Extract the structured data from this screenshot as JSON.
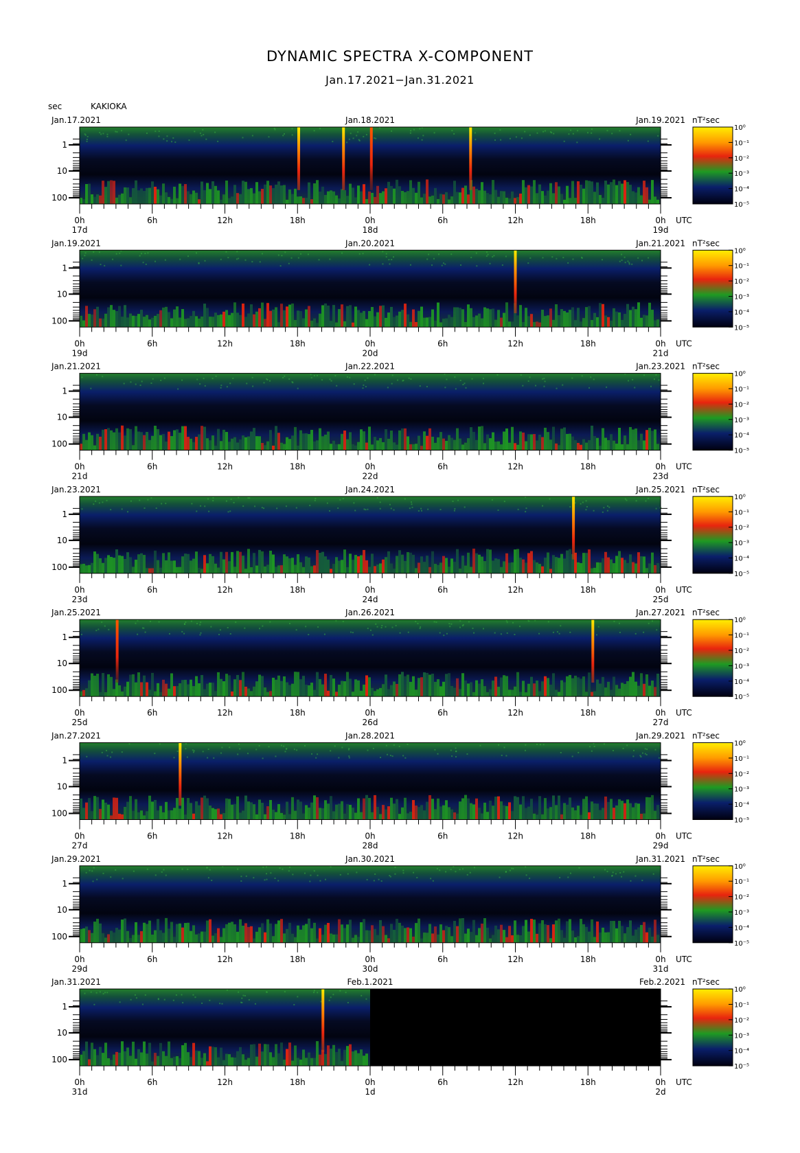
{
  "title": "DYNAMIC SPECTRA X-COMPONENT",
  "subtitle": "Jan.17.2021−Jan.31.2021",
  "unit_label": "sec",
  "station": "KAKIOKA",
  "colorbar_unit": "nT²sec",
  "colors": {
    "low": "#000000",
    "blue": "#0a1f6a",
    "green": "#1f9a22",
    "red": "#e8240e",
    "yellow": "#ffee00",
    "nodata": "#000000"
  },
  "chart_data": {
    "type": "heatmap",
    "xlabel": "UTC",
    "x_tick_labels": [
      "0h",
      "6h",
      "12h",
      "18h",
      "0h",
      "6h",
      "12h",
      "18h",
      "0h"
    ],
    "y_tick_labels": [
      "1",
      "10",
      "100"
    ],
    "y_scale": "log",
    "y_axis": "period (sec)",
    "colorbar_ticks": [
      "10⁰",
      "10⁻¹",
      "10⁻²",
      "10⁻³",
      "10⁻⁴",
      "10⁻⁵"
    ],
    "colorbar_range": [
      1e-05,
      1
    ],
    "panels": [
      {
        "left_date": "Jan.17.2021",
        "mid_date": "Jan.18.2021",
        "right_date": "Jan.19.2021",
        "day_labels": [
          "17d",
          "18d",
          "19d"
        ],
        "data_fraction": 1.0,
        "spikes": [
          {
            "hour": 18.1,
            "color": "yellow"
          },
          {
            "hour": 21.8,
            "color": "yellow"
          },
          {
            "hour": 24.1,
            "color": "red"
          },
          {
            "hour": 32.3,
            "color": "yellow"
          }
        ]
      },
      {
        "left_date": "Jan.19.2021",
        "mid_date": "Jan.20.2021",
        "right_date": "Jan.21.2021",
        "day_labels": [
          "19d",
          "20d",
          "21d"
        ],
        "data_fraction": 1.0,
        "spikes": [
          {
            "hour": 36.0,
            "color": "yellow"
          }
        ]
      },
      {
        "left_date": "Jan.21.2021",
        "mid_date": "Jan.22.2021",
        "right_date": "Jan.23.2021",
        "day_labels": [
          "21d",
          "22d",
          "23d"
        ],
        "data_fraction": 1.0,
        "spikes": []
      },
      {
        "left_date": "Jan.23.2021",
        "mid_date": "Jan.24.2021",
        "right_date": "Jan.25.2021",
        "day_labels": [
          "23d",
          "24d",
          "25d"
        ],
        "data_fraction": 1.0,
        "spikes": [
          {
            "hour": 40.8,
            "color": "yellow"
          }
        ]
      },
      {
        "left_date": "Jan.25.2021",
        "mid_date": "Jan.26.2021",
        "right_date": "Jan.27.2021",
        "day_labels": [
          "25d",
          "26d",
          "27d"
        ],
        "data_fraction": 1.0,
        "spikes": [
          {
            "hour": 3.1,
            "color": "red"
          },
          {
            "hour": 42.4,
            "color": "yellow"
          }
        ]
      },
      {
        "left_date": "Jan.27.2021",
        "mid_date": "Jan.28.2021",
        "right_date": "Jan.29.2021",
        "day_labels": [
          "27d",
          "28d",
          "29d"
        ],
        "data_fraction": 1.0,
        "spikes": [
          {
            "hour": 8.3,
            "color": "yellow"
          }
        ]
      },
      {
        "left_date": "Jan.29.2021",
        "mid_date": "Jan.30.2021",
        "right_date": "Jan.31.2021",
        "day_labels": [
          "29d",
          "30d",
          "31d"
        ],
        "data_fraction": 1.0,
        "spikes": []
      },
      {
        "left_date": "Jan.31.2021",
        "mid_date": "Feb.1.2021",
        "right_date": "Feb.2.2021",
        "day_labels": [
          "31d",
          "1d",
          "2d"
        ],
        "data_fraction": 0.5,
        "spikes": [
          {
            "hour": 20.1,
            "color": "yellow"
          }
        ]
      }
    ]
  }
}
